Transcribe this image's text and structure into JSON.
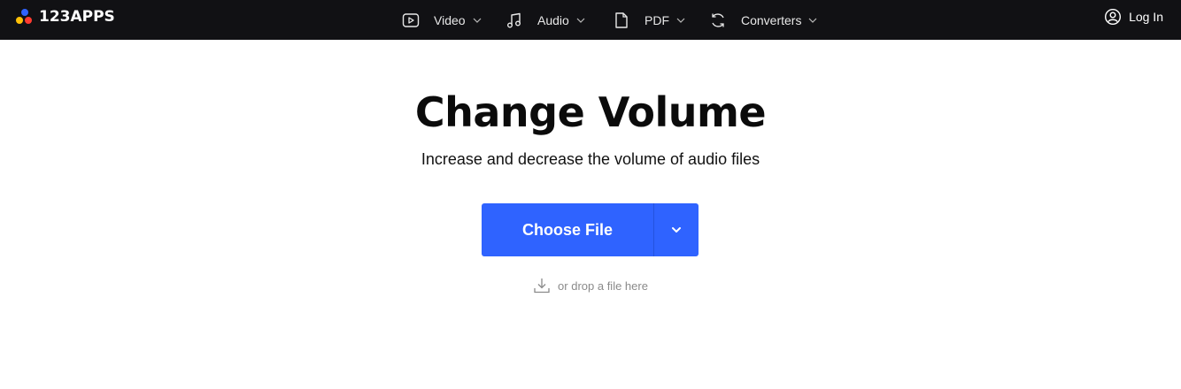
{
  "header": {
    "logo_text": "123APPS",
    "logo_colors": {
      "blue": "#2f63ff",
      "red": "#ff3b30",
      "yellow": "#ffc107"
    },
    "background": "#111114",
    "nav": [
      {
        "label": "Video",
        "icon": "video-icon"
      },
      {
        "label": "Audio",
        "icon": "music-note-icon"
      },
      {
        "label": "PDF",
        "icon": "document-icon"
      },
      {
        "label": "Converters",
        "icon": "convert-icon"
      }
    ],
    "login_label": "Log In"
  },
  "main": {
    "title": "Change Volume",
    "subtitle": "Increase and decrease the volume of audio files",
    "choose_file_label": "Choose File",
    "drop_hint": "or drop a file here",
    "accent": "#2f63ff"
  }
}
